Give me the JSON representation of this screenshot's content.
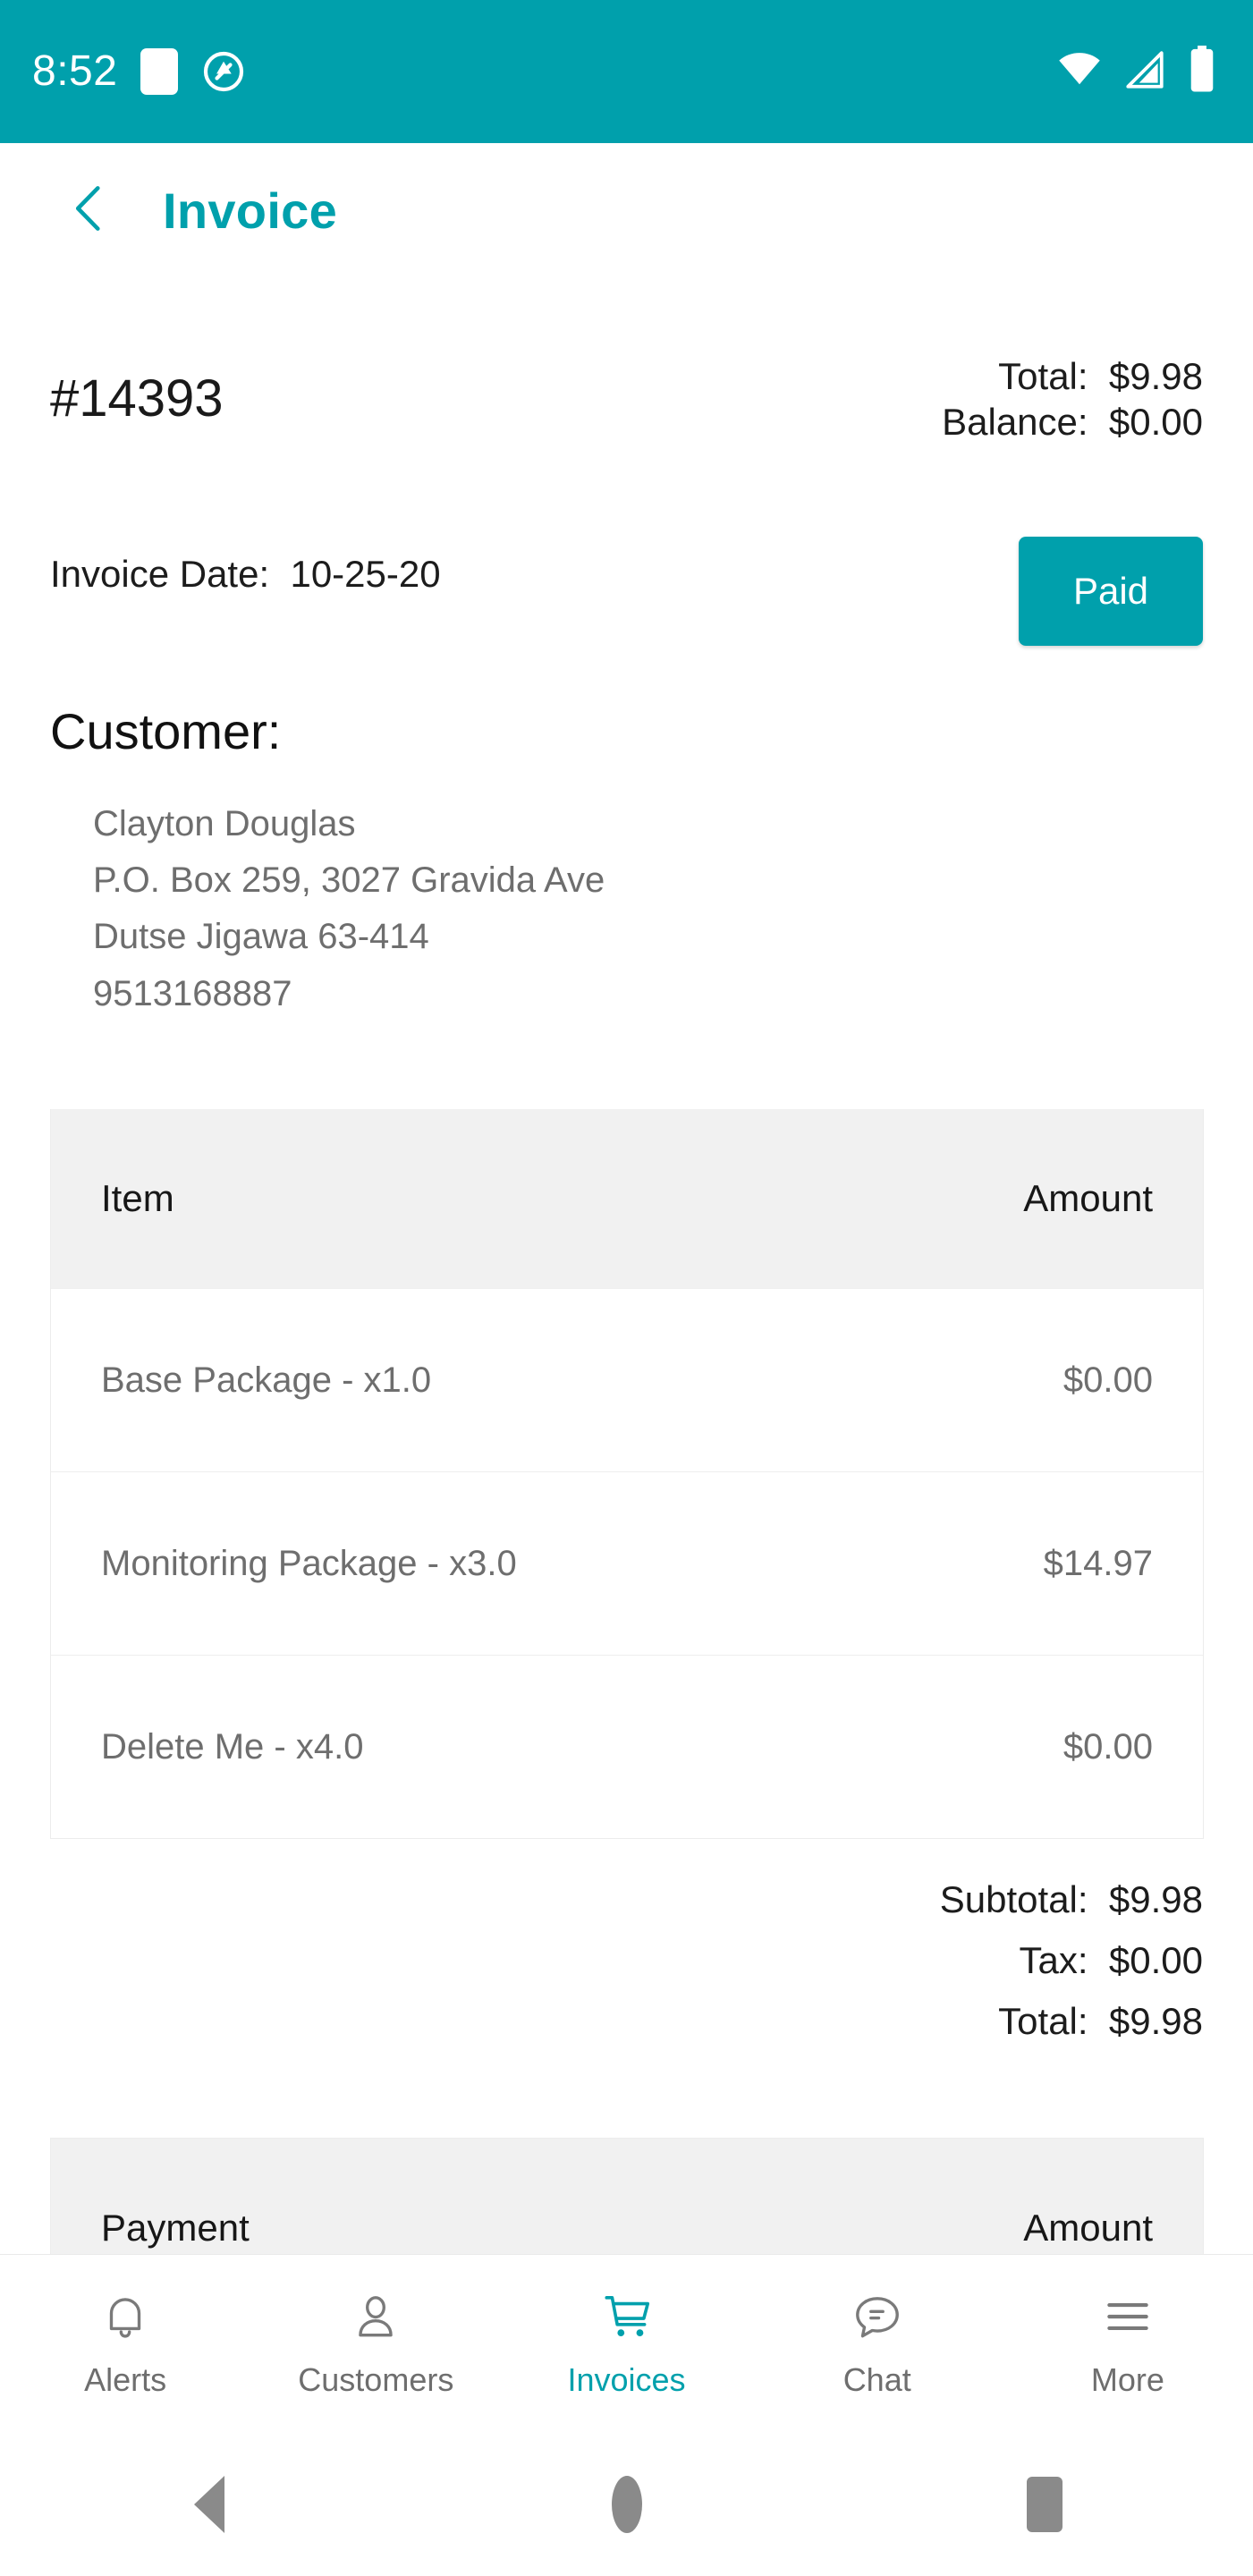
{
  "status_bar": {
    "time": "8:52",
    "left_icons": [
      "screenshot-square-icon",
      "do-not-disturb-icon"
    ],
    "right_icons": [
      "wifi-icon",
      "cellular-signal-icon",
      "battery-icon"
    ],
    "background_color": "#00a0ac"
  },
  "app_bar": {
    "back_icon": "chevron-left-icon",
    "title": "Invoice",
    "accent_color": "#00a0ac"
  },
  "invoice": {
    "number": "#14393",
    "total_label": "Total:  $9.98",
    "balance_label": "Balance:  $0.00",
    "date_label": "Invoice Date:  10-25-20",
    "status_badge": "Paid"
  },
  "customer": {
    "heading": "Customer:",
    "lines": [
      "Clayton Douglas",
      "P.O. Box 259, 3027 Gravida Ave",
      "Dutse Jigawa 63-414",
      "9513168887"
    ]
  },
  "items_table": {
    "columns": [
      "Item",
      "Amount"
    ],
    "rows": [
      {
        "item": "Base Package - x1.0",
        "amount": "$0.00"
      },
      {
        "item": "Monitoring Package - x3.0",
        "amount": "$14.97"
      },
      {
        "item": "Delete Me - x4.0",
        "amount": "$0.00"
      }
    ]
  },
  "totals": {
    "subtotal": "Subtotal:  $9.98",
    "tax": "Tax:  $0.00",
    "total": "Total:  $9.98"
  },
  "payments_table": {
    "columns": [
      "Payment",
      "Amount"
    ]
  },
  "bottom_nav": {
    "active": "Invoices",
    "items": [
      {
        "label": "Alerts",
        "icon": "bell-icon"
      },
      {
        "label": "Customers",
        "icon": "person-icon"
      },
      {
        "label": "Invoices",
        "icon": "shopping-cart-icon"
      },
      {
        "label": "Chat",
        "icon": "chat-bubble-icon"
      },
      {
        "label": "More",
        "icon": "hamburger-menu-icon"
      }
    ]
  },
  "system_nav": {
    "back": "back-triangle-icon",
    "home": "home-circle-icon",
    "recents": "recents-square-icon"
  }
}
